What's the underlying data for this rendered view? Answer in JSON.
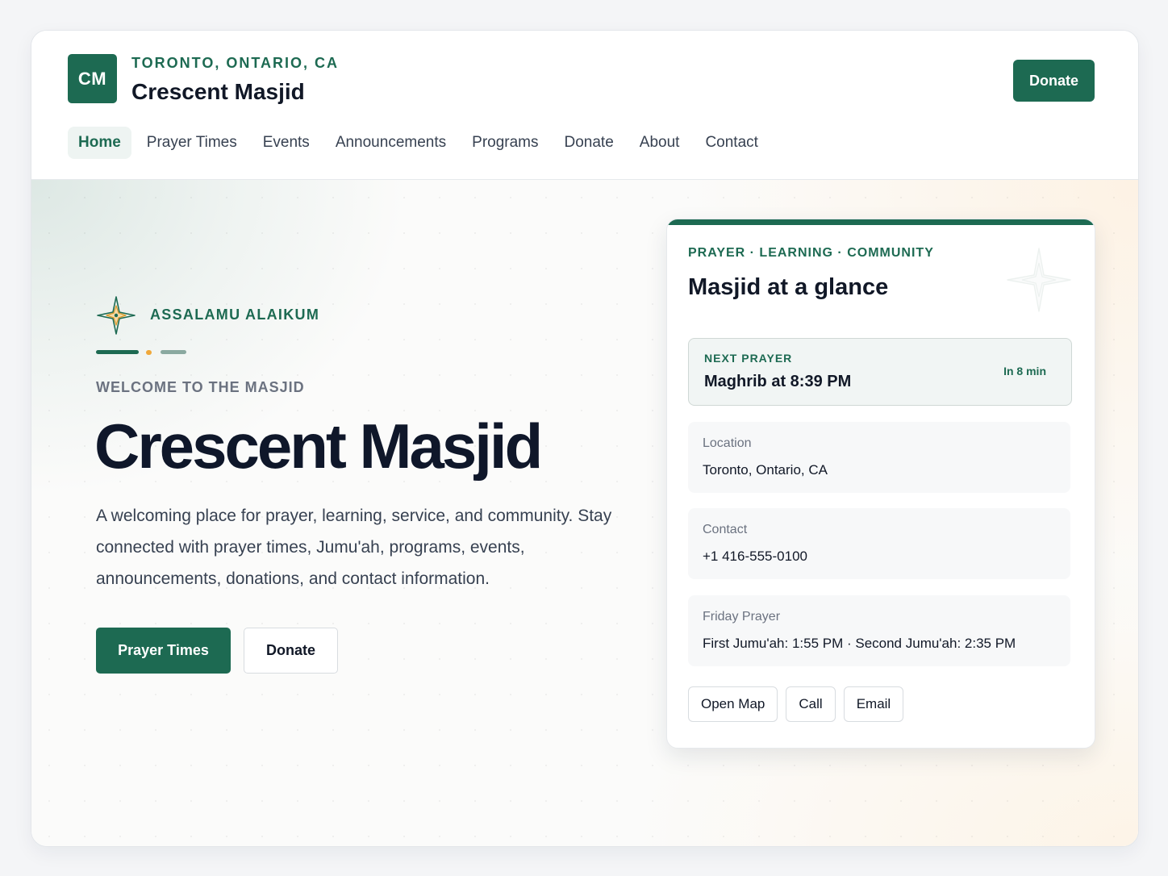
{
  "header": {
    "logo_text": "CM",
    "location": "TORONTO, ONTARIO, CA",
    "site_name": "Crescent Masjid",
    "donate_label": "Donate"
  },
  "nav": {
    "items": [
      {
        "label": "Home",
        "active": true
      },
      {
        "label": "Prayer Times"
      },
      {
        "label": "Events"
      },
      {
        "label": "Announcements"
      },
      {
        "label": "Programs"
      },
      {
        "label": "Donate"
      },
      {
        "label": "About"
      },
      {
        "label": "Contact"
      }
    ]
  },
  "hero": {
    "greeting": "ASSALAMU ALAIKUM",
    "welcome": "WELCOME TO THE MASJID",
    "title": "Crescent Masjid",
    "description": "A welcoming place for prayer, learning, service, and community. Stay connected with prayer times, Jumu'ah, programs, events, announcements, donations, and contact information.",
    "primary_button": "Prayer Times",
    "secondary_button": "Donate"
  },
  "card": {
    "kicker": "PRAYER · LEARNING · COMMUNITY",
    "title": "Masjid at a glance",
    "next_prayer": {
      "label": "NEXT PRAYER",
      "value": "Maghrib at 8:39 PM",
      "eta": "In 8 min"
    },
    "location": {
      "label": "Location",
      "value": "Toronto, Ontario, CA"
    },
    "contact": {
      "label": "Contact",
      "value": "+1 416-555-0100"
    },
    "friday": {
      "label": "Friday Prayer",
      "value": "First Jumu'ah: 1:55 PM · Second Jumu'ah: 2:35 PM"
    },
    "actions": {
      "map": "Open Map",
      "call": "Call",
      "email": "Email"
    }
  },
  "colors": {
    "brand": "#1d6a52",
    "accent": "#f0a83a"
  }
}
